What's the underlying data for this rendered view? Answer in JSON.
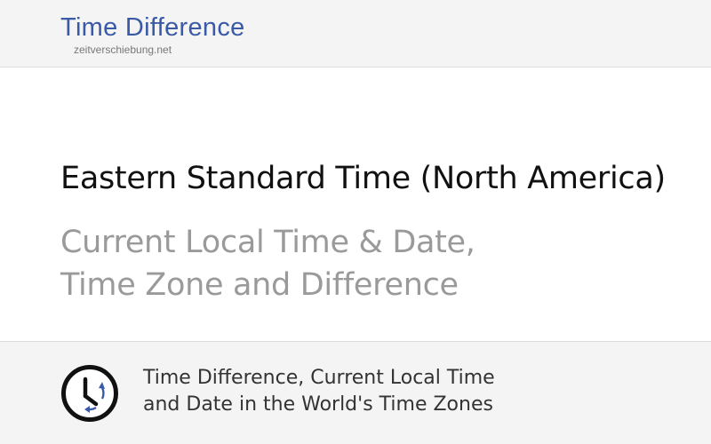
{
  "header": {
    "logo_title": "Time Difference",
    "logo_domain": "zeitverschiebung.net"
  },
  "main": {
    "title": "Eastern Standard Time (North America)",
    "subtitle_lines": [
      "Current Local Time & Date,",
      "Time Zone and Difference"
    ]
  },
  "footer": {
    "icon": "clock-icon",
    "text_lines": [
      "Time Difference, Current Local Time",
      "and Date in the World's Time Zones"
    ]
  },
  "colors": {
    "brand": "#3a5aa8",
    "title": "#111111",
    "subtitle": "#9a9a9a",
    "band_background": "#f4f4f4",
    "icon_arrows": "#3a5aa8"
  }
}
